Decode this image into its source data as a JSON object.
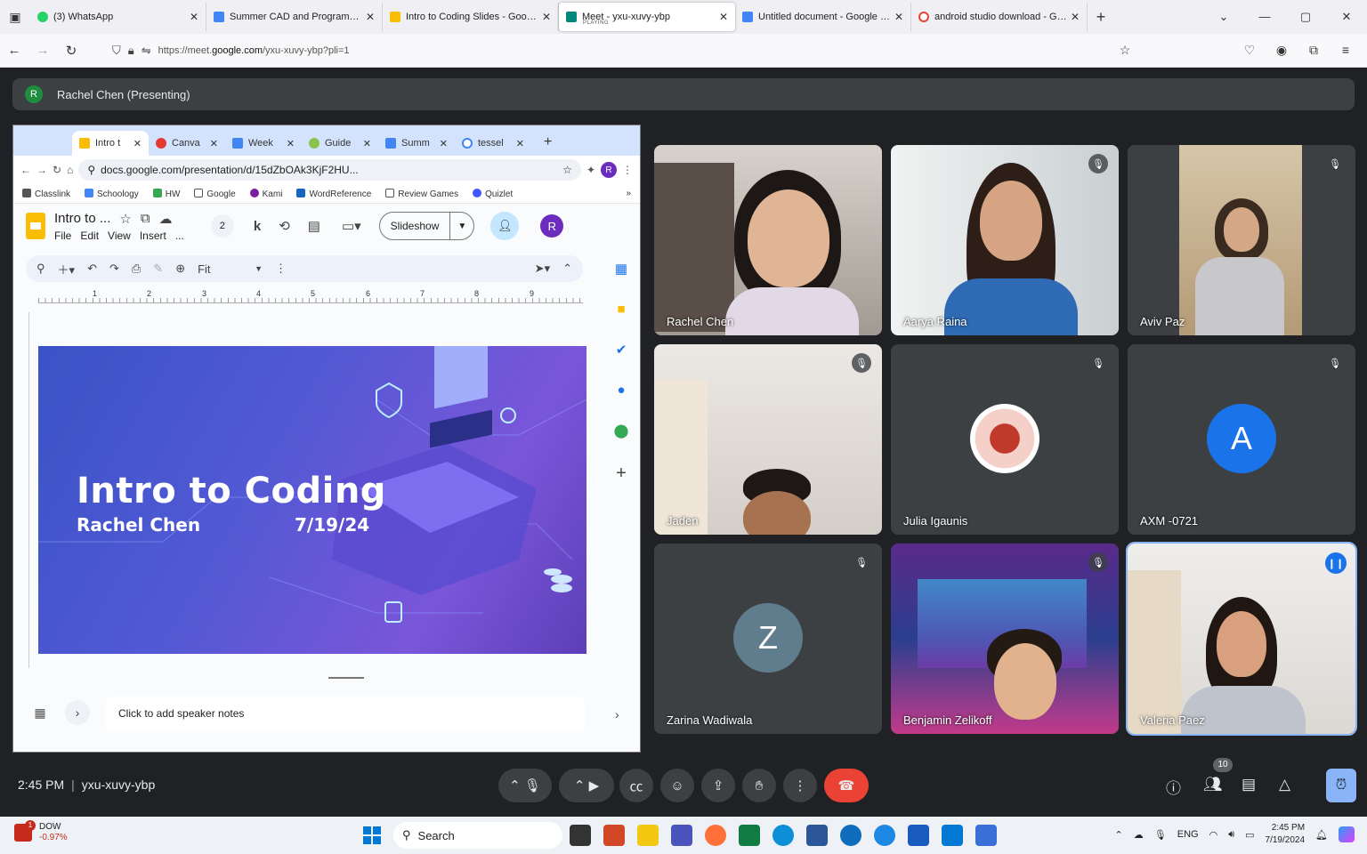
{
  "browser": {
    "tabs": [
      {
        "label": "(3) WhatsApp",
        "color": "#25d366"
      },
      {
        "label": "Summer CAD and Programming",
        "color": "#4285f4"
      },
      {
        "label": "Intro to Coding Slides - Google",
        "color": "#fbbc04"
      },
      {
        "label": "Meet - yxu-xuvy-ybp",
        "sub": "PLAYING",
        "color": "#00897b"
      },
      {
        "label": "Untitled document - Google Do",
        "color": "#4285f4"
      },
      {
        "label": "android studio download - Goo",
        "color": "#ea4335"
      }
    ],
    "url_prefix": "https://meet.",
    "url_domain": "google.com",
    "url_path": "/yxu-xuvy-ybp?pli=1"
  },
  "meet": {
    "presenter_initial": "R",
    "presenter_label": "Rachel Chen (Presenting)",
    "time": "2:45 PM",
    "meeting_code": "yxu-xuvy-ybp",
    "people_count": "10",
    "participants": [
      {
        "name": "Rachel Chen",
        "muted": false
      },
      {
        "name": "Aarya Raina",
        "muted": true
      },
      {
        "name": "Aviv Paz",
        "muted": true
      },
      {
        "name": "Jaden",
        "muted": true
      },
      {
        "name": "Julia Igaunis",
        "muted": true
      },
      {
        "name": "AXM -0721",
        "muted": true,
        "initial": "A"
      },
      {
        "name": "Zarina Wadiwala",
        "muted": true,
        "initial": "Z"
      },
      {
        "name": "Benjamin Zelikoff",
        "muted": true
      },
      {
        "name": "Valeria Paez",
        "muted": false,
        "speaking": true
      }
    ]
  },
  "shared": {
    "tabs": [
      "Intro t",
      "Canva",
      "Week",
      "Guide",
      "Summ",
      "tessel"
    ],
    "url": "docs.google.com/presentation/d/15dZbOAk3KjF2HU...",
    "bookmarks": [
      "Classlink",
      "Schoology",
      "HW",
      "Google",
      "Kami",
      "WordReference",
      "Review Games",
      "Quizlet"
    ],
    "doc_title": "Intro to ...",
    "menu": [
      "File",
      "Edit",
      "View",
      "Insert",
      "..."
    ],
    "comment_count": "2",
    "slideshow_label": "Slideshow",
    "user_initial": "R",
    "zoom": "Fit",
    "ruler": [
      "1",
      "2",
      "3",
      "4",
      "5",
      "6",
      "7",
      "8",
      "9"
    ],
    "slide": {
      "title": "Intro to Coding",
      "author": "Rachel Chen",
      "date": "7/19/24"
    },
    "notes_placeholder": "Click to add speaker notes"
  },
  "taskbar": {
    "stock_name": "DOW",
    "stock_change": "-0.97%",
    "stock_badge": "1",
    "search_label": "Search",
    "lang": "ENG",
    "time": "2:45 PM",
    "date": "7/19/2024"
  }
}
